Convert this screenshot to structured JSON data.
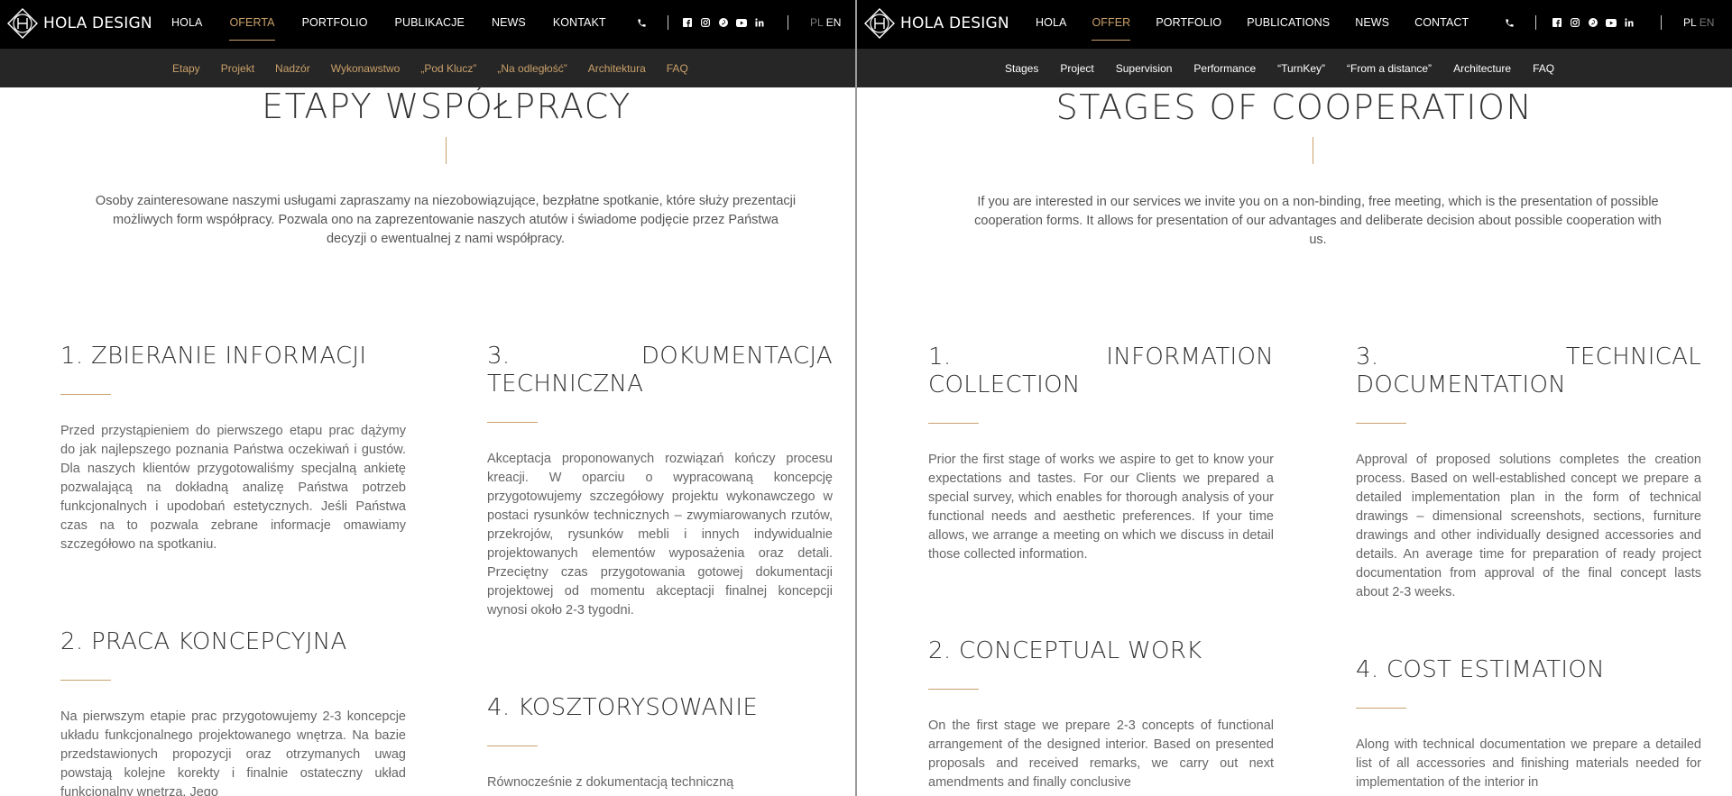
{
  "colors": {
    "accent": "#c9a06a",
    "topbar": "#000000",
    "subbar": "#262626"
  },
  "pl": {
    "brand": "HOLA DESIGN",
    "nav": [
      "HOLA",
      "OFERTA",
      "PORTFOLIO",
      "PUBLIKACJE",
      "NEWS",
      "KONTAKT"
    ],
    "active_nav": "OFERTA",
    "lang_pl": "PL",
    "lang_en": "EN",
    "subnav": [
      "Etapy",
      "Projekt",
      "Nadzór",
      "Wykonawstwo",
      "„Pod Klucz”",
      "„Na odległość”",
      "Architektura",
      "FAQ"
    ],
    "title": "ETAPY WSPÓŁPRACY",
    "intro": "Osoby zainteresowane naszymi usługami zapraszamy na niezobowiązujące, bezpłatne spotkanie, które służy prezentacji możliwych form współpracy. Pozwala ono na zaprezentowanie naszych atutów i świadome podjęcie przez Państwa decyzji o ewentualnej z nami współpracy.",
    "sections": [
      {
        "title": "1. ZBIERANIE INFORMACJI",
        "body": "Przed przystąpieniem do pierwszego etapu prac dążymy do jak najlepszego poznania Państwa oczekiwań i gustów. Dla naszych klientów przygotowaliśmy specjalną ankietę pozwalającą na dokładną analizę Państwa potrzeb funkcjonalnych i upodobań estetycznych. Jeśli Państwa czas na to pozwala zebrane informacje omawiamy szczegółowo na spotkaniu."
      },
      {
        "title": "2. PRACA KONCEPCYJNA",
        "body": "Na pierwszym etapie prac przygotowujemy 2-3 koncepcje układu funkcjonalnego projektowanego wnętrza. Na bazie przedstawionych propozycji oraz otrzymanych uwag powstają kolejne korekty i finalnie ostateczny układ funkcjonalny wnętrza. Jego"
      },
      {
        "title": "3. DOKUMENTACJA TECHNICZNA",
        "body": "Akceptacja proponowanych rozwiązań kończy procesu kreacji. W oparciu o wypracowaną koncepcję przygotowujemy szczegółowy projektu wykonawczego w postaci rysunków technicznych – zwymiarowanych rzutów, przekrojów, rysunków mebli i innych indywidualnie projektowanych elementów wyposażenia oraz detali. Przeciętny czas przygotowania gotowej dokumentacji projektowej od momentu akceptacji finalnej koncepcji wynosi około 2-3 tygodni."
      },
      {
        "title": "4. KOSZTORYSOWANIE",
        "body": "Równocześnie z dokumentacją techniczną"
      }
    ]
  },
  "en": {
    "brand": "HOLA DESIGN",
    "nav": [
      "HOLA",
      "OFFER",
      "PORTFOLIO",
      "PUBLICATIONS",
      "NEWS",
      "CONTACT"
    ],
    "active_nav": "OFFER",
    "lang_pl": "PL",
    "lang_en": "EN",
    "subnav": [
      "Stages",
      "Project",
      "Supervision",
      "Performance",
      "“TurnKey”",
      "“From a distance”",
      "Architecture",
      "FAQ"
    ],
    "title": "STAGES OF COOPERATION",
    "intro": "If you are interested in our services we invite you on a non-binding, free meeting, which is the presentation of possible cooperation forms. It allows for presentation of our advantages and deliberate decision about possible cooperation with us.",
    "sections": [
      {
        "title": "1. INFORMATION COLLECTION",
        "body": "Prior the first stage of works we aspire to get to know your expectations and tastes. For our Clients we prepared a special survey, which enables for thorough analysis of your functional needs and aesthetic preferences. If your time allows, we arrange a meeting on which we discuss in detail those collected information."
      },
      {
        "title": "2. CONCEPTUAL WORK",
        "body": "On the first stage we prepare 2-3 concepts of functional arrangement of the designed interior. Based on presented proposals and received remarks, we carry out next amendments and finally conclusive"
      },
      {
        "title": "3. TECHNICAL DOCUMENTATION",
        "body": "Approval of proposed solutions completes the creation process. Based on well-established concept we prepare a detailed implementation plan in the form of technical drawings – dimensional screenshots, sections, furniture drawings and other individually designed accessories and details. An average time for preparation of ready project documentation from approval of the final concept lasts about 2-3 weeks."
      },
      {
        "title": "4. COST ESTIMATION",
        "body": "Along with technical documentation we prepare a detailed list of all accessories and finishing materials needed for implementation of the interior in"
      }
    ]
  }
}
